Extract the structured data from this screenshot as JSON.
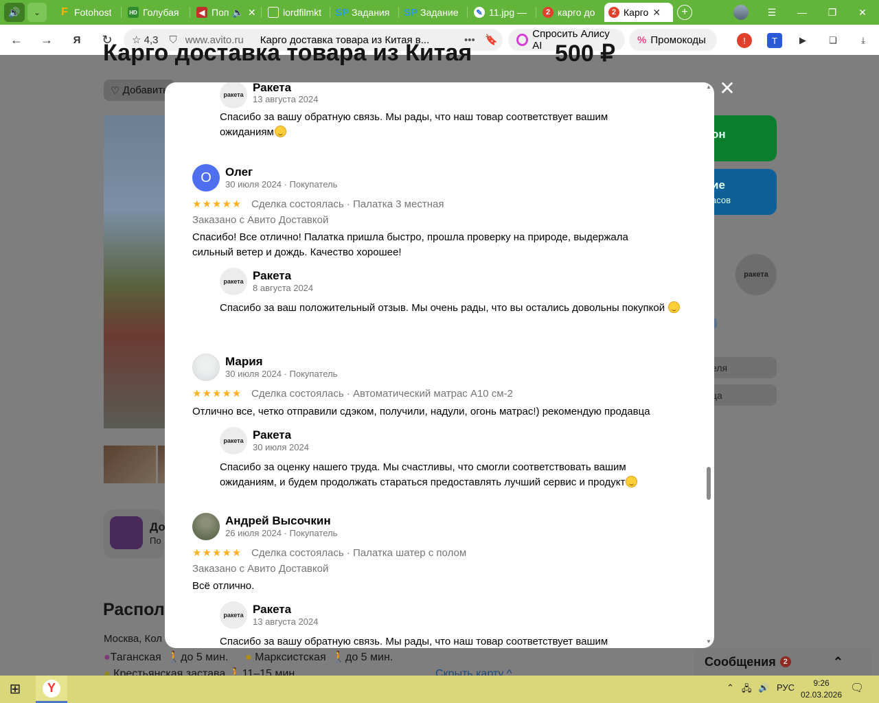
{
  "browser": {
    "tabs": [
      {
        "title": "Fotohost",
        "icon": "F"
      },
      {
        "title": "Голубая",
        "icon": "HD"
      },
      {
        "title": "Поп",
        "icon": "play"
      },
      {
        "title": "lordfilmkt",
        "icon": "doc"
      },
      {
        "title": "Задания",
        "icon": "SP"
      },
      {
        "title": "Задание",
        "icon": "SP"
      },
      {
        "title": "11.jpg —",
        "icon": "feather"
      },
      {
        "title": "карго до",
        "icon": "2"
      },
      {
        "title": "Карго",
        "icon": "2"
      }
    ],
    "address": {
      "rating": "4,3",
      "domain": "www.avito.ru",
      "page_title": "Карго доставка товара из Китая в..."
    },
    "alice_label": "Спросить Алису AI",
    "promo_label": "Промокоды"
  },
  "background_page": {
    "title": "Карго доставка товара из Китая",
    "price": "500 ₽",
    "favorite_label": "Добавить",
    "btn_green": "он",
    "btn_blue_1": "ие",
    "btn_blue_2": "асов",
    "seller_logo": "ракета",
    "badge": "е",
    "gray_btn_1": "еля",
    "gray_btn_2": "ца",
    "promo_title": "До",
    "promo_sub": "По",
    "location_heading": "Распол",
    "address_text": "Москва, Кол",
    "metro": [
      {
        "name": "Таганская",
        "time": "до 5 мин.",
        "color": "#8e4a8e"
      },
      {
        "name": "Марксистская",
        "time": "до 5 мин.",
        "color": "#e0b020"
      },
      {
        "name": "Крестьянская застава",
        "time": "11–15 мин.",
        "color": "#b0b030"
      }
    ],
    "hide_map": "Скрыть карту",
    "messages_label": "Сообщения",
    "messages_count": "2"
  },
  "reviews": [
    {
      "type": "reply",
      "author": "Ракета",
      "date": "13 августа 2024",
      "text": "Спасибо за вашу обратную связь. Мы рады, что наш товар соответствует вашим ожиданиям"
    },
    {
      "type": "review",
      "author": "Олег",
      "initial": "О",
      "meta": "30 июля 2024 · Покупатель",
      "stars": "★★★★★",
      "deal": "Сделка состоялась · Палатка 3 местная",
      "delivery": "Заказано с Авито Доставкой",
      "text": "Спасибо! Все отлично! Палатка пришла быстро, прошла проверку на природе, выдержала сильный ветер и дождь. Качество хорошее!"
    },
    {
      "type": "reply",
      "author": "Ракета",
      "date": "8 августа 2024",
      "text": "Спасибо за ваш положительный отзыв. Мы очень рады, что вы остались довольны покупкой"
    },
    {
      "type": "review",
      "author": "Мария",
      "meta": "30 июля 2024 · Покупатель",
      "stars": "★★★★★",
      "deal": "Сделка состоялась · Автоматический матрас A10 см-2",
      "text": "Отлично все, четко отправили сдэком, получили, надули, огонь матрас!) рекомендую продавца"
    },
    {
      "type": "reply",
      "author": "Ракета",
      "date": "30 июля 2024",
      "text": "Спасибо за оценку нашего труда. Мы счастливы, что смогли соответствовать вашим ожиданиям, и будем продолжать стараться предоставлять лучший сервис и продукт"
    },
    {
      "type": "review",
      "author": "Андрей Высочкин",
      "meta": "26 июля 2024 · Покупатель",
      "stars": "★★★★★",
      "deal": "Сделка состоялась · Палатка шатер с полом",
      "delivery": "Заказано с Авито Доставкой",
      "text": "Всё отлично."
    },
    {
      "type": "reply",
      "author": "Ракета",
      "date": "13 августа 2024",
      "text": "Спасибо за вашу обратную связь. Мы рады, что наш товар соответствует вашим"
    }
  ],
  "taskbar": {
    "lang": "РУС",
    "time": "9:26",
    "date": "02.03.2026"
  },
  "colors": {
    "tabbar": "#63b43a",
    "star": "#ffb021",
    "avatar_blue": "#4e70f0",
    "taskbar": "#d9d77a"
  }
}
